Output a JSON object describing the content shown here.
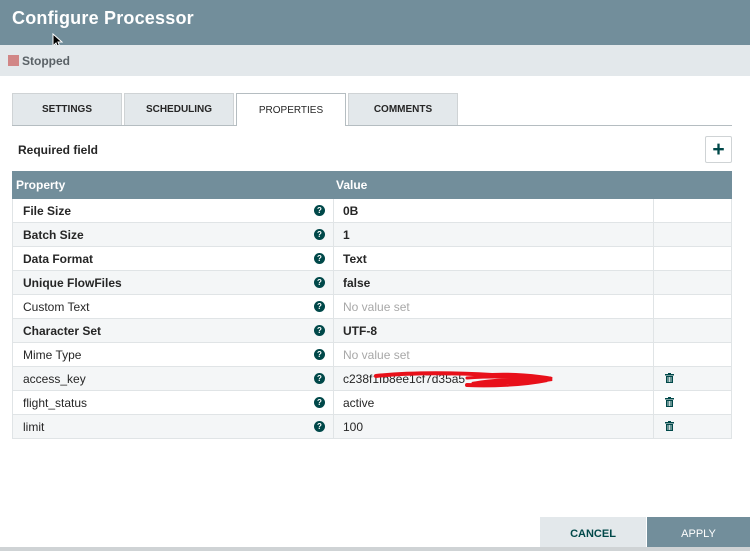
{
  "dialog": {
    "title": "Configure Processor",
    "status": "Stopped",
    "status_color": "#d18686"
  },
  "tabs": [
    {
      "label": "SETTINGS",
      "active": false
    },
    {
      "label": "SCHEDULING",
      "active": false
    },
    {
      "label": "PROPERTIES",
      "active": true
    },
    {
      "label": "COMMENTS",
      "active": false
    }
  ],
  "properties": {
    "required_label": "Required field",
    "add_icon": "plus-icon",
    "columns": [
      "Property",
      "Value"
    ],
    "rows": [
      {
        "name": "File Size",
        "value": "0B",
        "required": true,
        "deletable": false
      },
      {
        "name": "Batch Size",
        "value": "1",
        "required": true,
        "deletable": false
      },
      {
        "name": "Data Format",
        "value": "Text",
        "required": true,
        "deletable": false
      },
      {
        "name": "Unique FlowFiles",
        "value": "false",
        "required": true,
        "deletable": false
      },
      {
        "name": "Custom Text",
        "value": "No value set",
        "required": false,
        "deletable": false,
        "empty": true
      },
      {
        "name": "Character Set",
        "value": "UTF-8",
        "required": true,
        "deletable": false
      },
      {
        "name": "Mime Type",
        "value": "No value set",
        "required": false,
        "deletable": false,
        "empty": true
      },
      {
        "name": "access_key",
        "value": "c238f1fb8ee1cf7d35a5",
        "required": false,
        "deletable": true
      },
      {
        "name": "flight_status",
        "value": "active",
        "required": false,
        "deletable": true
      },
      {
        "name": "limit",
        "value": "100",
        "required": false,
        "deletable": true
      }
    ]
  },
  "footer": {
    "cancel_label": "CANCEL",
    "apply_label": "APPLY"
  },
  "colors": {
    "header": "#728e9b",
    "accent": "#004849",
    "redaction": "#e8101a"
  }
}
